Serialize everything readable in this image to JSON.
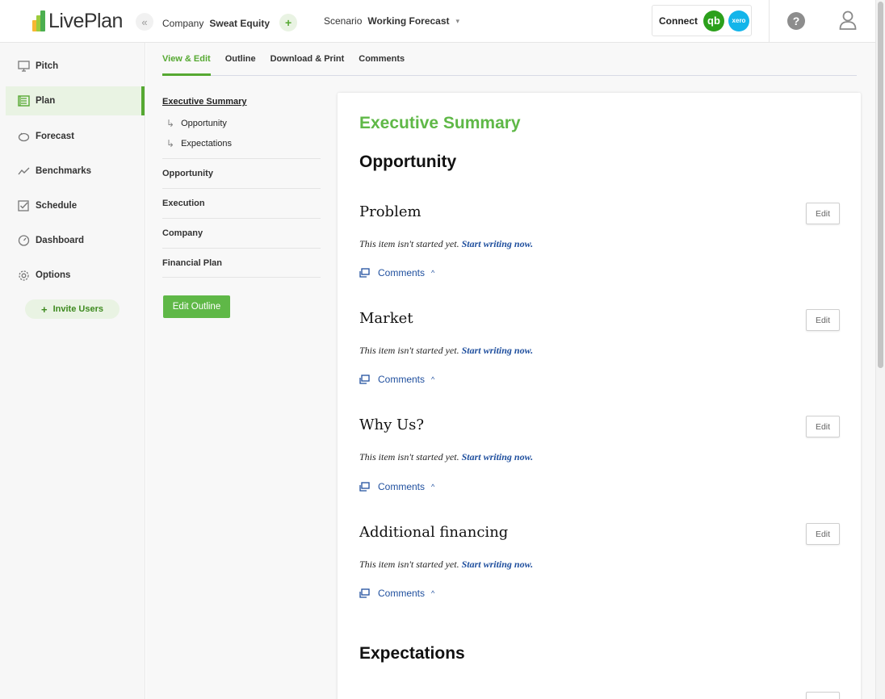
{
  "app": {
    "logo_text": "LivePlan"
  },
  "header": {
    "company_label": "Company",
    "company_value": "Sweat Equity",
    "scenario_label": "Scenario",
    "scenario_value": "Working Forecast",
    "connect_label": "Connect",
    "qb_label": "qb",
    "xero_label": "xero",
    "help_label": "?"
  },
  "sidebar": {
    "items": [
      {
        "label": "Pitch",
        "icon": "monitor-icon"
      },
      {
        "label": "Plan",
        "icon": "plan-icon"
      },
      {
        "label": "Forecast",
        "icon": "piggy-bank-icon"
      },
      {
        "label": "Benchmarks",
        "icon": "trend-icon"
      },
      {
        "label": "Schedule",
        "icon": "checkbox-icon"
      },
      {
        "label": "Dashboard",
        "icon": "gauge-icon"
      },
      {
        "label": "Options",
        "icon": "gear-icon"
      }
    ],
    "active": "Plan",
    "invite_label": "Invite Users"
  },
  "tabs": [
    {
      "label": "View & Edit"
    },
    {
      "label": "Outline"
    },
    {
      "label": "Download & Print"
    },
    {
      "label": "Comments"
    }
  ],
  "outline": {
    "head": "Executive Summary",
    "subs": [
      "Opportunity",
      "Expectations"
    ],
    "items": [
      "Opportunity",
      "Execution",
      "Company",
      "Financial Plan"
    ],
    "edit_button": "Edit Outline"
  },
  "content": {
    "page_heading": "Executive Summary",
    "heading_opportunity": "Opportunity",
    "heading_expectations": "Expectations",
    "sections": [
      {
        "title": "Problem",
        "status": "This item isn't started yet.",
        "link": "Start writing now."
      },
      {
        "title": "Market",
        "status": "This item isn't started yet.",
        "link": "Start writing now."
      },
      {
        "title": "Why Us?",
        "status": "This item isn't started yet.",
        "link": "Start writing now."
      },
      {
        "title": "Additional financing",
        "status": "This item isn't started yet.",
        "link": "Start writing now."
      }
    ],
    "edit_label": "Edit",
    "comments_label": "Comments"
  },
  "colors": {
    "accent": "#5fb847",
    "link": "#1f4f9e",
    "active_bg": "#e9f3e3"
  }
}
